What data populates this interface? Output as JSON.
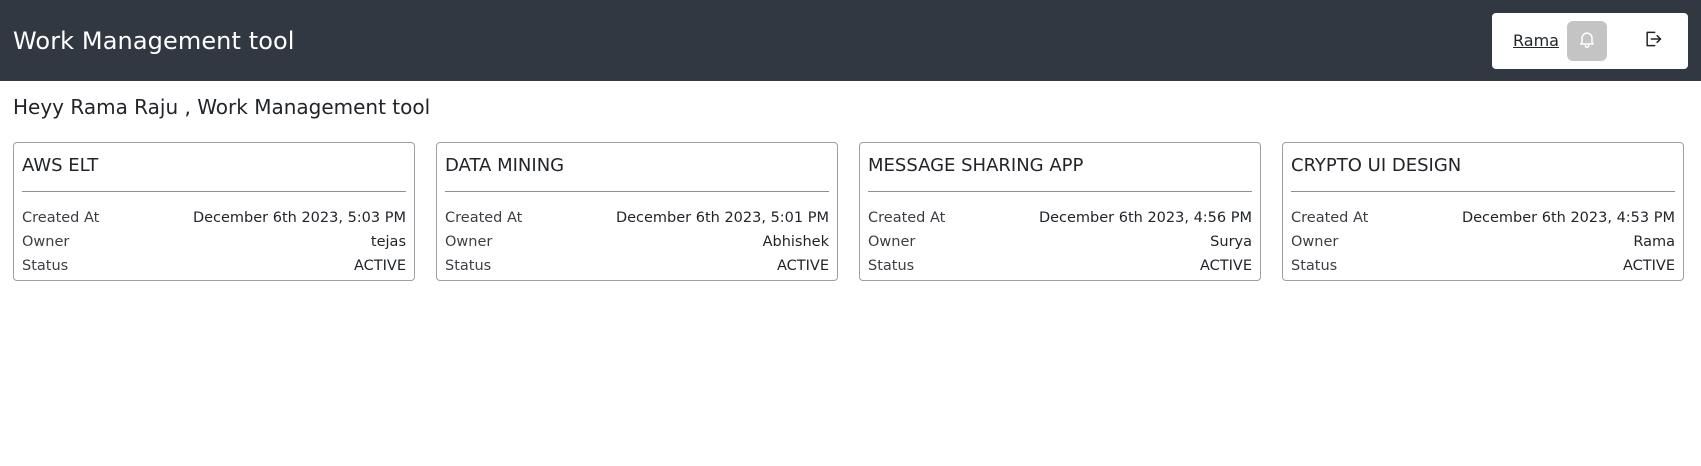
{
  "header": {
    "title": "Work Management tool",
    "user_name": "Rama",
    "bell_icon": "bell-icon",
    "logout_icon": "logout-icon",
    "bg_color": "#313841"
  },
  "greeting": "Heyy Rama Raju , Work Management tool",
  "labels": {
    "created_at": "Created At",
    "owner": "Owner",
    "status": "Status"
  },
  "projects": [
    {
      "name": "AWS ELT",
      "created_at": "December 6th 2023, 5:03 PM",
      "owner": "tejas",
      "status": "ACTIVE"
    },
    {
      "name": "DATA MINING",
      "created_at": "December 6th 2023, 5:01 PM",
      "owner": "Abhishek",
      "status": "ACTIVE"
    },
    {
      "name": "MESSAGE SHARING APP",
      "created_at": "December 6th 2023, 4:56 PM",
      "owner": "Surya",
      "status": "ACTIVE"
    },
    {
      "name": "CRYPTO UI DESIGN",
      "created_at": "December 6th 2023, 4:53 PM",
      "owner": "Rama",
      "status": "ACTIVE"
    }
  ]
}
